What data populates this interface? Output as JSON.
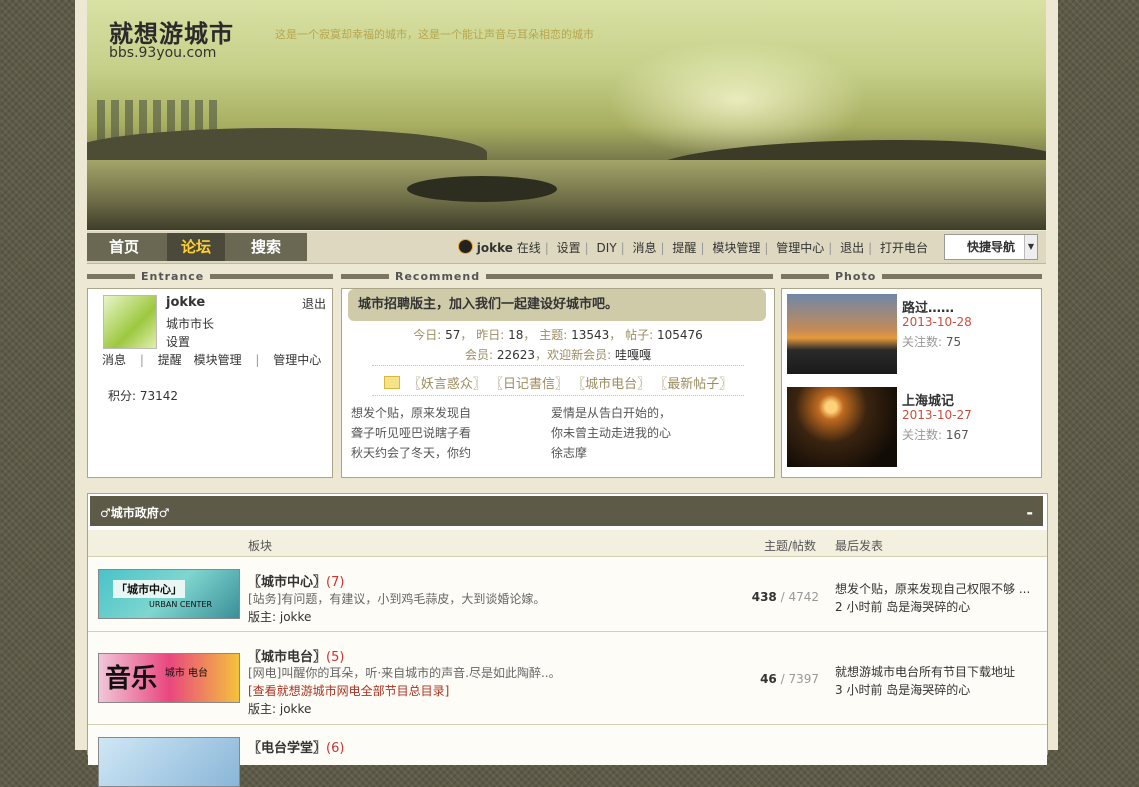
{
  "site": {
    "logo_text": "就想游城市",
    "logo_url": "bbs.93you.com",
    "slogan": "这是一个寂寞却幸福的城市，这是一个能让声音与耳朵相恋的城市"
  },
  "nav": {
    "items": [
      "首页",
      "论坛",
      "搜索"
    ],
    "active": "论坛",
    "user": "jokke",
    "status": "在线",
    "links": [
      "设置",
      "DIY",
      "消息",
      "提醒",
      "模块管理",
      "管理中心",
      "退出",
      "打开电台"
    ],
    "quick_nav": "快捷导航"
  },
  "sections": {
    "entrance": "Entrance",
    "recommend": "Recommend",
    "photo": "Photo"
  },
  "entrance": {
    "username": "jokke",
    "logout": "退出",
    "rank": "城市市长",
    "settings": "设置",
    "links": [
      "消息",
      "提醒",
      "模块管理",
      "管理中心"
    ],
    "score_label": "积分:",
    "score": "73142"
  },
  "recommend": {
    "notice": "城市招聘版主，加入我们一起建设好城市吧。",
    "stats1": {
      "today_l": "今日:",
      "today": "57",
      "yest_l": "昨日:",
      "yest": "18",
      "topics_l": "主题:",
      "topics": "13543",
      "posts_l": "帖子:",
      "posts": "105476"
    },
    "stats2": {
      "members_l": "会员:",
      "members": "22623",
      "new_l": "欢迎新会员:",
      "new": "哇嘎嘎"
    },
    "tags": [
      "〖妖言惑众〗",
      "〖日记書信〗",
      "〖城市电台〗",
      "〖最新帖子〗"
    ],
    "poem_left": [
      "想发个贴，原来发现自",
      "聋子听见哑巴说瞎子看",
      "秋天约会了冬天，你约"
    ],
    "poem_right": [
      "爱情是从告白开始的，",
      "你未曾主动走进我的心",
      "徐志摩"
    ]
  },
  "photos": [
    {
      "title": "路过……",
      "date": "2013-10-28",
      "views_label": "关注数:",
      "views": "75"
    },
    {
      "title": "上海城记",
      "date": "2013-10-27",
      "views_label": "关注数:",
      "views": "167"
    }
  ],
  "forum": {
    "category": "♂城市政府♂",
    "collapse": "-",
    "columns": {
      "board": "板块",
      "counts": "主题/帖数",
      "last": "最后发表"
    },
    "boards": [
      {
        "name": "〖城市中心〗",
        "today": "(7)",
        "desc": "[站务]有问题，有建议，小到鸡毛蒜皮，大到谈婚论嫁。",
        "extra": "",
        "mod_label": "版主:",
        "mod": "jokke",
        "topics": "438",
        "posts": "4742",
        "last_title": "想发个贴，原来发现自己权限不够 ...",
        "last_time": "2 小时前",
        "last_user": "岛是海哭碎的心",
        "icon_text": "「城市中心」",
        "icon_sub": "URBAN CENTER"
      },
      {
        "name": "〖城市电台〗",
        "today": "(5)",
        "desc": "[网电]叫醒你的耳朵，听·来自城市的声音.尽是如此陶醉..。",
        "extra": "[查看就想游城市网电全部节目总目录]",
        "mod_label": "版主:",
        "mod": "jokke",
        "topics": "46",
        "posts": "7397",
        "last_title": "就想游城市电台所有节目下载地址",
        "last_time": "3 小时前",
        "last_user": "岛是海哭碎的心",
        "icon_text": "音乐",
        "icon_sub": "城市 电台"
      },
      {
        "name": "〖电台学堂〗",
        "today": "(6)"
      }
    ]
  },
  "colors": {
    "accent": "#ffd232",
    "date": "#c8503c",
    "count": "#c33333"
  }
}
